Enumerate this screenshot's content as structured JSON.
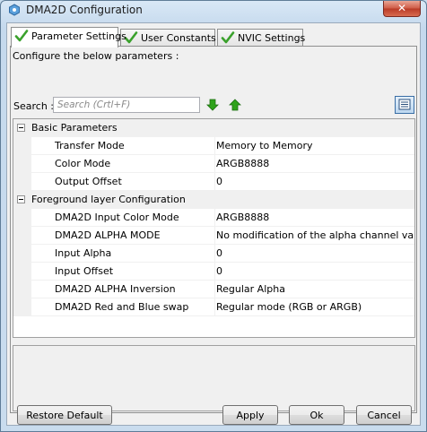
{
  "window": {
    "title": "DMA2D Configuration",
    "close_label": "✕"
  },
  "tabs": [
    {
      "label": "Parameter Settings",
      "active": true
    },
    {
      "label": "User Constants",
      "active": false
    },
    {
      "label": "NVIC Settings",
      "active": false
    }
  ],
  "panel": {
    "instructions": "Configure the below parameters :",
    "search_label": "Search :",
    "search_placeholder": "Search (Crtl+F)"
  },
  "groups": [
    {
      "label": "Basic Parameters",
      "expanded": true,
      "items": [
        {
          "name": "Transfer Mode",
          "value": "Memory to Memory"
        },
        {
          "name": "Color Mode",
          "value": "ARGB8888"
        },
        {
          "name": "Output Offset",
          "value": "0"
        }
      ]
    },
    {
      "label": "Foreground layer Configuration",
      "expanded": true,
      "items": [
        {
          "name": "DMA2D Input Color Mode",
          "value": "ARGB8888"
        },
        {
          "name": "DMA2D ALPHA MODE",
          "value": "No modification of the alpha channel value"
        },
        {
          "name": "Input Alpha",
          "value": "0"
        },
        {
          "name": "Input Offset",
          "value": "0"
        },
        {
          "name": "DMA2D ALPHA Inversion",
          "value": "Regular Alpha"
        },
        {
          "name": "DMA2D Red and Blue swap",
          "value": "Regular mode (RGB or ARGB)"
        }
      ]
    }
  ],
  "buttons": {
    "restore_default": "Restore Default",
    "apply": "Apply",
    "ok": "Ok",
    "cancel": "Cancel"
  },
  "icons": {
    "check": "green-check-icon",
    "down": "green-down-arrow-icon",
    "up": "green-up-arrow-icon",
    "view": "list-view-icon"
  },
  "colors": {
    "check_green": "#3aa12c",
    "arrow_green": "#2fa31a",
    "close_red": "#c8462e"
  }
}
